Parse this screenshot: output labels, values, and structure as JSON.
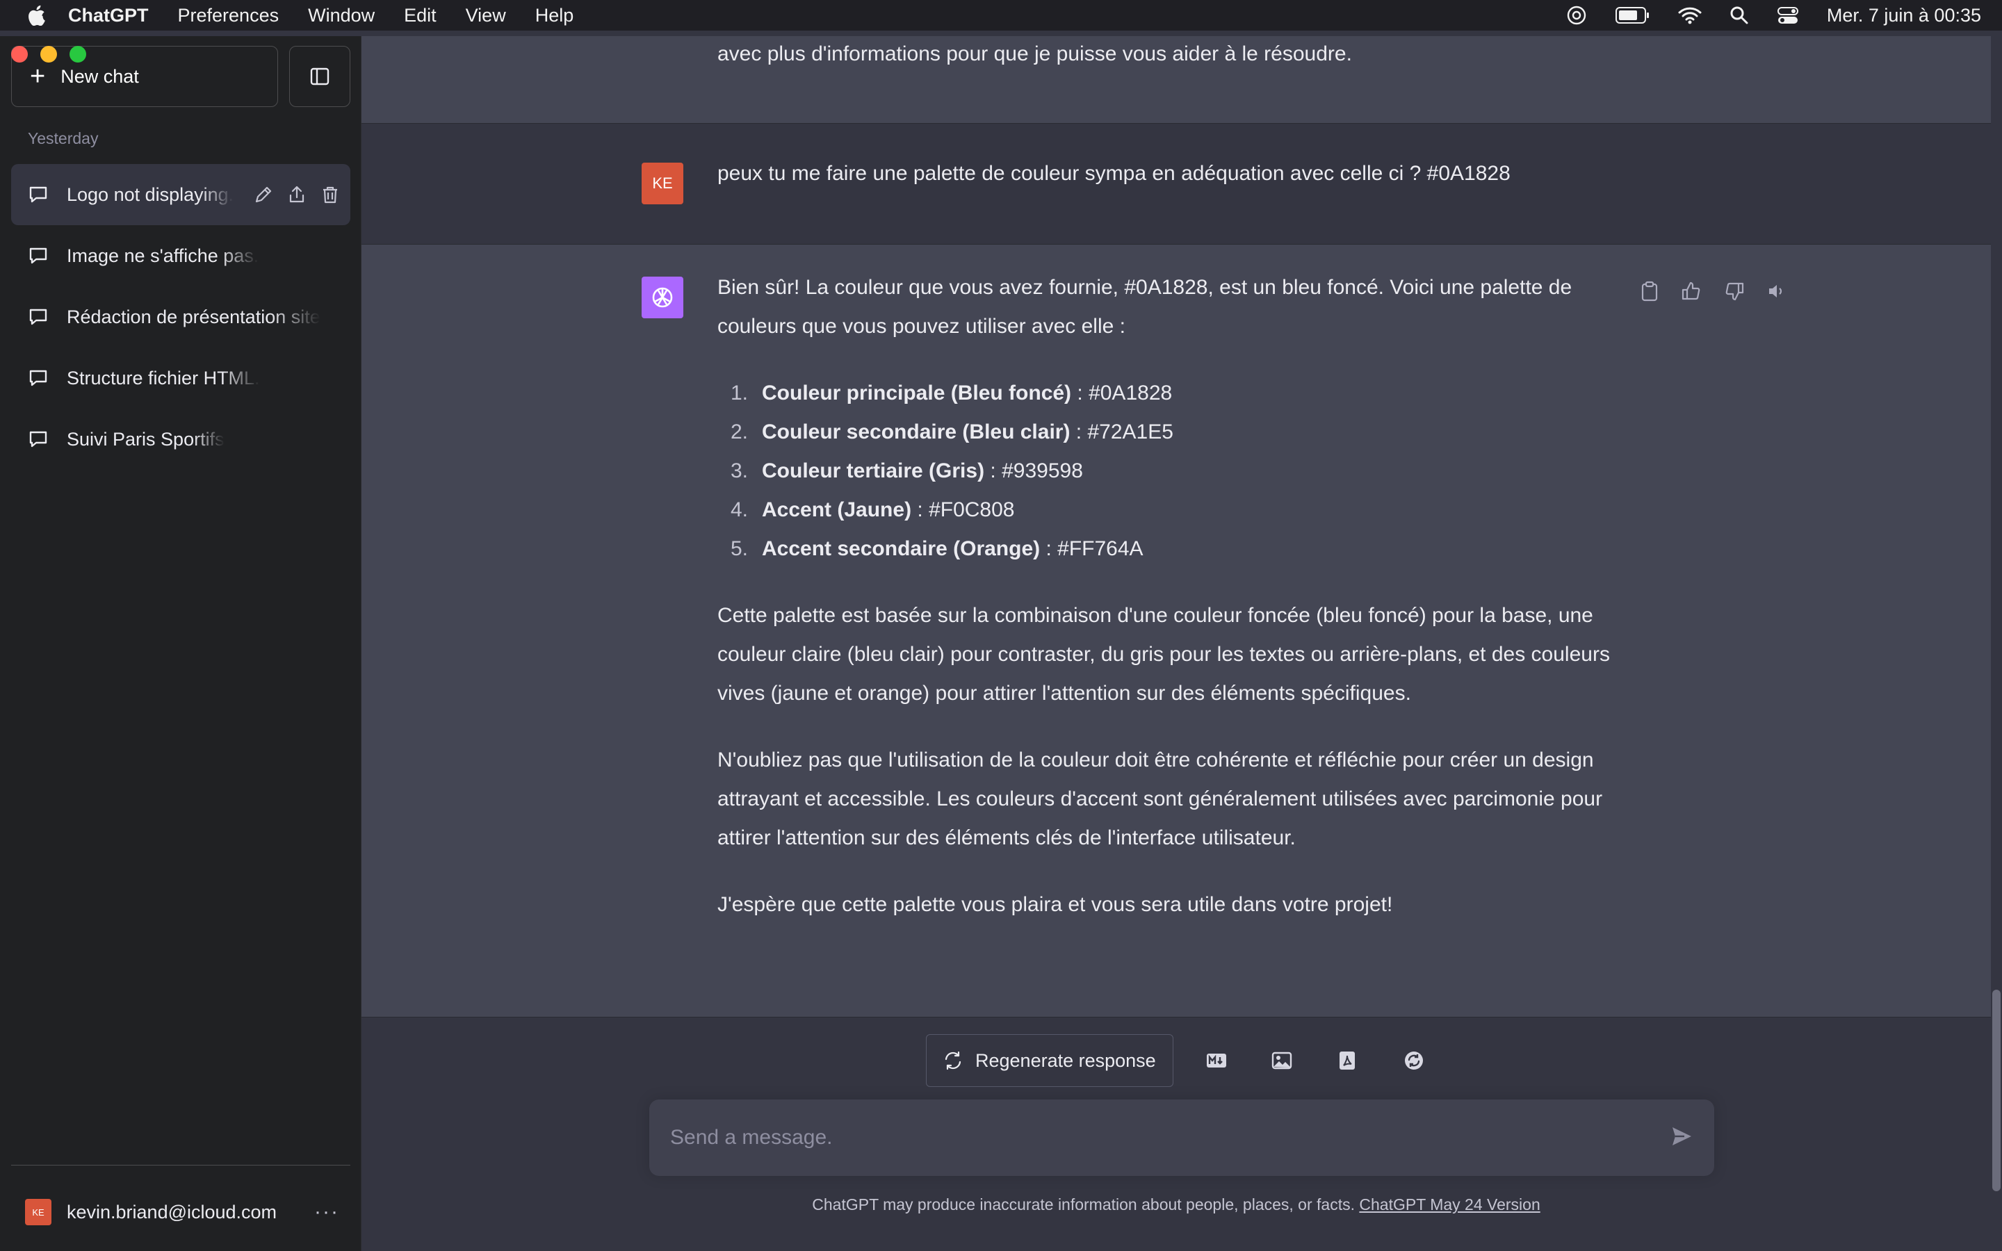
{
  "menubar": {
    "app_name": "ChatGPT",
    "items": [
      "Preferences",
      "Window",
      "Edit",
      "View",
      "Help"
    ],
    "datetime": "Mer. 7 juin à 00:35"
  },
  "sidebar": {
    "new_chat_label": "New chat",
    "section_label": "Yesterday",
    "chats": [
      {
        "label": "Logo not displaying."
      },
      {
        "label": "Image ne s'affiche pas."
      },
      {
        "label": "Rédaction de présentation site"
      },
      {
        "label": "Structure fichier HTML."
      },
      {
        "label": "Suivi Paris Sportifs"
      }
    ],
    "account": {
      "initials": "KE",
      "email": "kevin.briand@icloud.com",
      "more": "···"
    }
  },
  "conversation": {
    "prev_assistant_tail": "avec plus d'informations pour que je puisse vous aider à le résoudre.",
    "user_initials": "KE",
    "user_message": "peux tu me faire une palette de couleur sympa en adéquation avec celle ci ? #0A1828",
    "assistant_intro": "Bien sûr! La couleur que vous avez fournie, #0A1828, est un bleu foncé. Voici une palette de couleurs que vous pouvez utiliser avec elle :",
    "palette": [
      {
        "num": "1.",
        "name": "Couleur principale (Bleu foncé)",
        "value": " : #0A1828"
      },
      {
        "num": "2.",
        "name": "Couleur secondaire (Bleu clair)",
        "value": " : #72A1E5"
      },
      {
        "num": "3.",
        "name": "Couleur tertiaire (Gris)",
        "value": " : #939598"
      },
      {
        "num": "4.",
        "name": "Accent (Jaune)",
        "value": " : #F0C808"
      },
      {
        "num": "5.",
        "name": "Accent secondaire (Orange)",
        "value": " : #FF764A"
      }
    ],
    "paragraph_1": "Cette palette est basée sur la combinaison d'une couleur foncée (bleu foncé) pour la base, une couleur claire (bleu clair) pour contraster, du gris pour les textes ou arrière-plans, et des couleurs vives (jaune et orange) pour attirer l'attention sur des éléments spécifiques.",
    "paragraph_2": "N'oubliez pas que l'utilisation de la couleur doit être cohérente et réfléchie pour créer un design attrayant et accessible. Les couleurs d'accent sont généralement utilisées avec parcimonie pour attirer l'attention sur des éléments clés de l'interface utilisateur.",
    "paragraph_3": "J'espère que cette palette vous plaira et vous sera utile dans votre projet!"
  },
  "actions": {
    "regenerate_label": "Regenerate response"
  },
  "composer": {
    "placeholder": "Send a message."
  },
  "footer": {
    "note": "ChatGPT may produce inaccurate information about people, places, or facts.",
    "version_link": "ChatGPT May 24 Version"
  },
  "colors": {
    "sidebar_bg": "#202123",
    "main_bg": "#343541",
    "assistant_bg": "#444654",
    "user_avatar": "#d8553a",
    "gpt_avatar": "#ab68ff"
  },
  "icons": [
    "apple-icon",
    "openai-icon",
    "battery-icon",
    "wifi-icon",
    "search-icon",
    "control-center-icon",
    "sidebar-toggle-icon",
    "chat-bubble-icon",
    "edit-icon",
    "share-icon",
    "trash-icon",
    "copy-icon",
    "thumbs-up-icon",
    "thumbs-down-icon",
    "speaker-icon",
    "refresh-icon",
    "markdown-icon",
    "image-icon",
    "pdf-icon",
    "sync-icon",
    "send-icon"
  ]
}
